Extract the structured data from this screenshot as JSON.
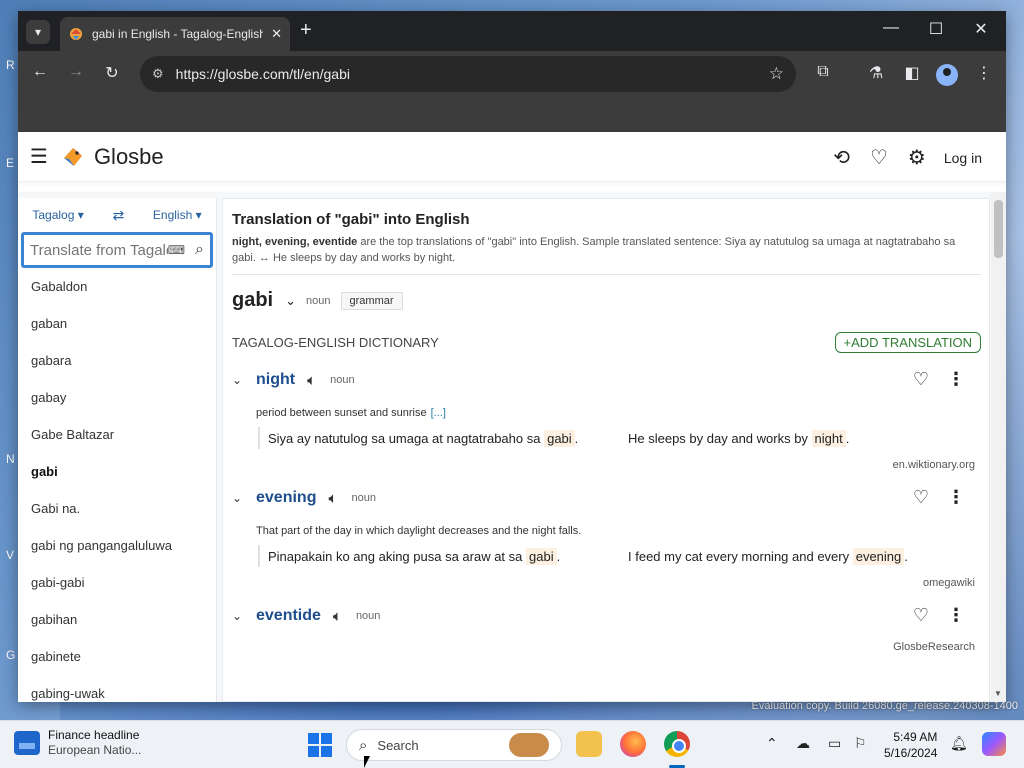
{
  "browser": {
    "tab_title": "gabi in English - Tagalog-English",
    "url": "https://glosbe.com/tl/en/gabi"
  },
  "site": {
    "logo_text": "Glosbe",
    "login_label": "Log in"
  },
  "sidebar": {
    "source_lang": "Tagalog",
    "target_lang": "English",
    "search_placeholder": "Translate from Tagalog",
    "words": [
      {
        "label": "Gabaldon"
      },
      {
        "label": "gaban"
      },
      {
        "label": "gabara"
      },
      {
        "label": "gabay"
      },
      {
        "label": "Gabe Baltazar"
      },
      {
        "label": "gabi",
        "active": true
      },
      {
        "label": "Gabi na."
      },
      {
        "label": "gabi ng pangangaluluwa"
      },
      {
        "label": "gabi-gabi"
      },
      {
        "label": "gabihan"
      },
      {
        "label": "gabinete"
      },
      {
        "label": "gabing-uwak"
      }
    ]
  },
  "main": {
    "heading": "Translation of \"gabi\" into English",
    "summary_bold": "night, evening, eventide",
    "summary_rest": " are the top translations of \"gabi\" into English. Sample translated sentence: Siya ay natutulog sa umaga at nagtatrabaho sa gabi. ↔ He sleeps by day and works by night.",
    "headword": "gabi",
    "headword_pos": "noun",
    "grammar_label": "grammar",
    "dict_label": "TAGALOG-ENGLISH DICTIONARY",
    "add_translation_label": "+ADD TRANSLATION",
    "entries": [
      {
        "word": "night",
        "pos": "noun",
        "definition": "period between sunset and sunrise",
        "definition_more": "[...]",
        "ex_src_before": "Siya ay natutulog sa umaga at nagtatrabaho sa ",
        "ex_src_hl": "gabi",
        "ex_src_after": ".",
        "ex_tgt_before": "He sleeps by day and works by ",
        "ex_tgt_hl": "night",
        "ex_tgt_after": ".",
        "source": "en.wiktionary.org"
      },
      {
        "word": "evening",
        "pos": "noun",
        "definition": "That part of the day in which daylight decreases and the night falls.",
        "ex_src_before": "Pinapakain ko ang aking pusa sa araw at sa ",
        "ex_src_hl": "gabi",
        "ex_src_after": ".",
        "ex_tgt_before": "I feed my cat every morning and every ",
        "ex_tgt_hl": "evening",
        "ex_tgt_after": ".",
        "source": "omegawiki"
      },
      {
        "word": "eventide",
        "pos": "noun",
        "source": "GlosbeResearch"
      }
    ]
  },
  "desktop": {
    "watermark": "Evaluation copy. Build 26080.ge_release.240308-1400"
  },
  "taskbar": {
    "news_title": "Finance headline",
    "news_subtitle": "European Natio...",
    "search_label": "Search",
    "time": "5:49 AM",
    "date": "5/16/2024"
  }
}
